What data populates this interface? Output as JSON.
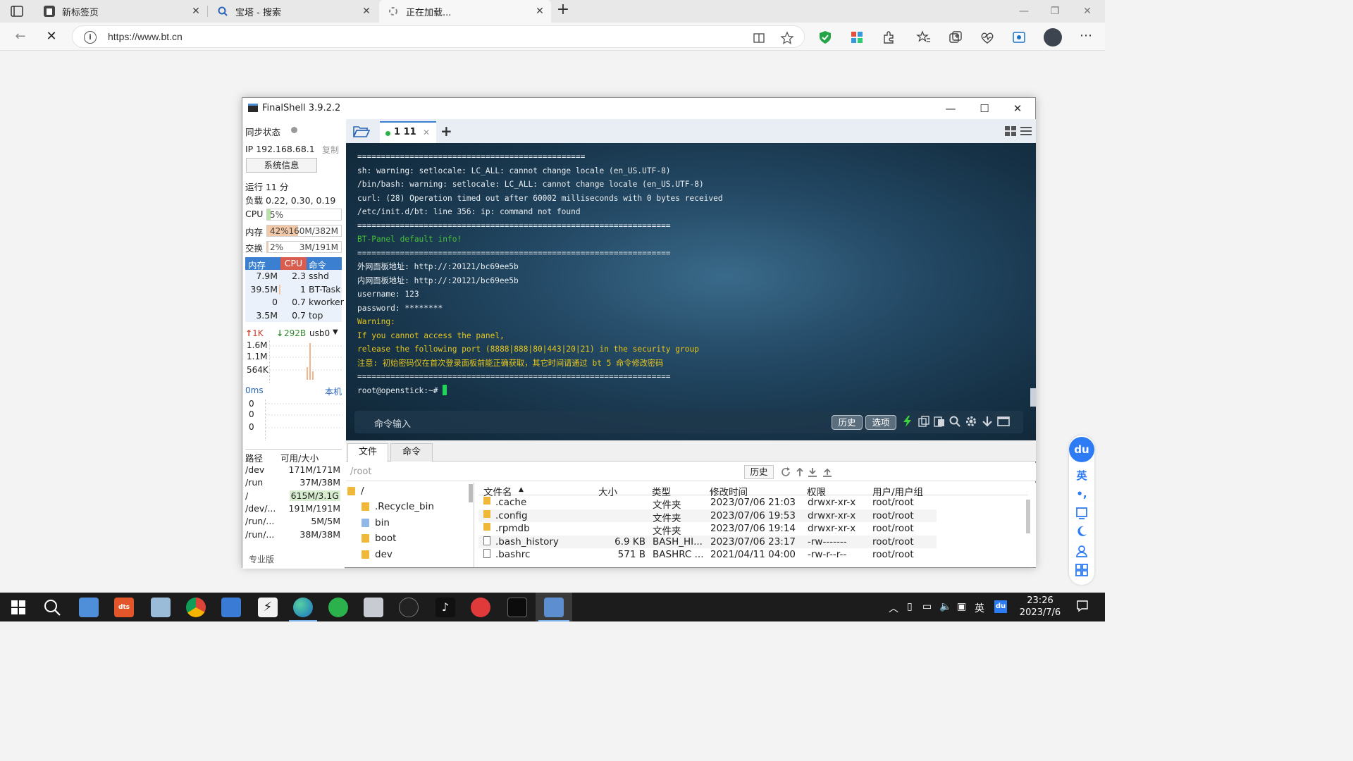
{
  "browser": {
    "tabs": [
      {
        "title": "新标签页",
        "state": "inactive"
      },
      {
        "title": "宝塔 - 搜索",
        "state": "inactive"
      },
      {
        "title": "正在加载...",
        "state": "active"
      }
    ],
    "url": "https://www.bt.cn"
  },
  "finalshell": {
    "title": "FinalShell 3.9.2.2",
    "sidebar": {
      "sync_label": "同步状态",
      "ip_label": "IP 192.168.68.1",
      "copy_label": "复制",
      "sysinfo_button": "系统信息",
      "uptime": "运行 11 分",
      "load": "负载 0.22, 0.30, 0.19",
      "cpu": {
        "label": "CPU",
        "value": "5%",
        "fraction": 0.05
      },
      "mem": {
        "label": "内存",
        "value": "42%",
        "detail": "160M/382M",
        "fraction": 0.42
      },
      "swap": {
        "label": "交换",
        "value": "2%",
        "detail": "3M/191M",
        "fraction": 0.02
      },
      "proc_headers": {
        "mem": "内存",
        "cpu": "CPU",
        "cmd": "命令"
      },
      "processes": [
        {
          "mem": "7.9M",
          "cpu": "2.3",
          "cmd": "sshd",
          "cpu_frac": 0.0
        },
        {
          "mem": "39.5M",
          "cpu": "1",
          "cmd": "BT-Task",
          "cpu_frac": 0.05
        },
        {
          "mem": "0",
          "cpu": "0.7",
          "cmd": "kworker",
          "cpu_frac": 0.0
        },
        {
          "mem": "3.5M",
          "cpu": "0.7",
          "cmd": "top",
          "cpu_frac": 0.0
        }
      ],
      "net": {
        "up": "1K",
        "down": "292B",
        "iface": "usb0",
        "y_labels": [
          "1.6M",
          "1.1M",
          "564K"
        ]
      },
      "ping": {
        "label": "0ms",
        "target": "本机",
        "y_labels": [
          "0",
          "0",
          "0"
        ]
      },
      "disk_headers": {
        "path": "路径",
        "size": "可用/大小"
      },
      "disks": [
        {
          "path": "/dev",
          "size": "171M/171M"
        },
        {
          "path": "/run",
          "size": "37M/38M"
        },
        {
          "path": "/",
          "size": "615M/3.1G"
        },
        {
          "path": "/dev/...",
          "size": "191M/191M"
        },
        {
          "path": "/run/...",
          "size": "5M/5M"
        },
        {
          "path": "/run/...",
          "size": "38M/38M"
        }
      ],
      "pro_label": "专业版"
    },
    "session_tab": "1 11",
    "terminal": {
      "lines": [
        {
          "text": "================================================",
          "color": "white"
        },
        {
          "text": "sh: warning: setlocale: LC_ALL: cannot change locale (en_US.UTF-8)",
          "color": "white"
        },
        {
          "text": "/bin/bash: warning: setlocale: LC_ALL: cannot change locale (en_US.UTF-8)",
          "color": "white"
        },
        {
          "text": "curl: (28) Operation timed out after 60002 milliseconds with 0 bytes received",
          "color": "white"
        },
        {
          "text": "/etc/init.d/bt: line 356: ip: command not found",
          "color": "white"
        },
        {
          "text": "==================================================================",
          "color": "white"
        },
        {
          "text": "BT-Panel default info!",
          "color": "green"
        },
        {
          "text": "==================================================================",
          "color": "white"
        },
        {
          "text": "外网面板地址: http://:20121/bc69ee5b",
          "color": "white"
        },
        {
          "text": "内网面板地址: http://:20121/bc69ee5b",
          "color": "white"
        },
        {
          "text": "username: 123",
          "color": "white"
        },
        {
          "text": "password: ********",
          "color": "white"
        },
        {
          "text": "Warning:",
          "color": "yellow"
        },
        {
          "text": "If you cannot access the panel,",
          "color": "yellow"
        },
        {
          "text": "release the following port (8888|888|80|443|20|21) in the security group",
          "color": "yellow"
        },
        {
          "text": "注意: 初始密码仅在首次登录面板前能正确获取，其它时间请通过 bt 5 命令修改密码",
          "color": "yellow"
        },
        {
          "text": "==================================================================",
          "color": "white"
        },
        {
          "text": "root@openstick:~#",
          "color": "white"
        }
      ],
      "command_input_label": "命令输入",
      "history_button": "历史",
      "options_button": "选项"
    },
    "files": {
      "tabs": [
        "文件",
        "命令"
      ],
      "path": "/root",
      "history_button": "历史",
      "tree": [
        "/",
        ".Recycle_bin",
        "bin",
        "boot",
        "dev"
      ],
      "headers": {
        "name": "文件名",
        "size": "大小",
        "type": "类型",
        "mtime": "修改时间",
        "perm": "权限",
        "owner": "用户/用户组"
      },
      "rows": [
        {
          "name": ".cache",
          "size": "",
          "type": "文件夹",
          "mtime": "2023/07/06 21:03",
          "perm": "drwxr-xr-x",
          "owner": "root/root",
          "kind": "folder"
        },
        {
          "name": ".config",
          "size": "",
          "type": "文件夹",
          "mtime": "2023/07/06 19:53",
          "perm": "drwxr-xr-x",
          "owner": "root/root",
          "kind": "folder"
        },
        {
          "name": ".rpmdb",
          "size": "",
          "type": "文件夹",
          "mtime": "2023/07/06 19:14",
          "perm": "drwxr-xr-x",
          "owner": "root/root",
          "kind": "folder"
        },
        {
          "name": ".bash_history",
          "size": "6.9 KB",
          "type": "BASH_HI...",
          "mtime": "2023/07/06 23:17",
          "perm": "-rw-------",
          "owner": "root/root",
          "kind": "file"
        },
        {
          "name": ".bashrc",
          "size": "571 B",
          "type": "BASHRC ...",
          "mtime": "2021/04/11 04:00",
          "perm": "-rw-r--r--",
          "owner": "root/root",
          "kind": "file"
        }
      ]
    }
  },
  "side_tools": {
    "logo": "du",
    "items": [
      "英"
    ]
  },
  "taskbar": {
    "tray_lang": "英",
    "time": "23:26",
    "date": "2023/7/6"
  },
  "colors": {
    "accent": "#3b7fd1",
    "cpu_header": "#d95c4e",
    "terminal_green": "#44c236",
    "terminal_yellow": "#e6c619"
  }
}
